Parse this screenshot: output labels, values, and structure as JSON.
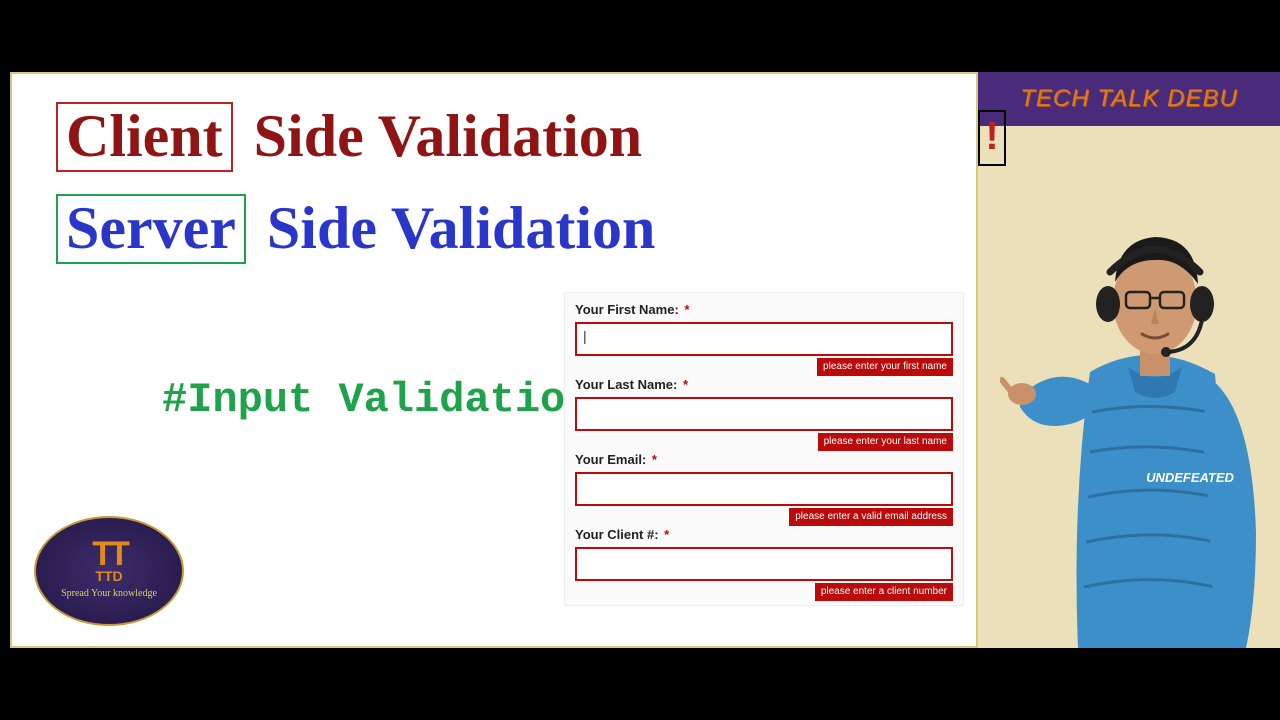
{
  "banner": {
    "text": "TECH TALK DEBU",
    "exclaim": "!"
  },
  "titles": {
    "client_word": "Client",
    "client_rest": "Side Validation",
    "server_word": "Server",
    "server_rest": "Side Validation",
    "hashtag": "#Input Validation"
  },
  "logo": {
    "tt": "TT",
    "ttd": "TTD",
    "slogan": "Spread Your knowledge"
  },
  "form": {
    "fields": [
      {
        "label": "Your First Name:",
        "star": "*",
        "value": "|",
        "error": "please enter your first name"
      },
      {
        "label": "Your Last Name:",
        "star": "*",
        "value": "",
        "error": "please enter your last name"
      },
      {
        "label": "Your Email:",
        "star": "*",
        "value": "",
        "error": "please enter a valid email address"
      },
      {
        "label": "Your Client #:",
        "star": "*",
        "value": "",
        "error": "please enter a client number"
      }
    ]
  },
  "shirt_text": "UNDEFEATED"
}
